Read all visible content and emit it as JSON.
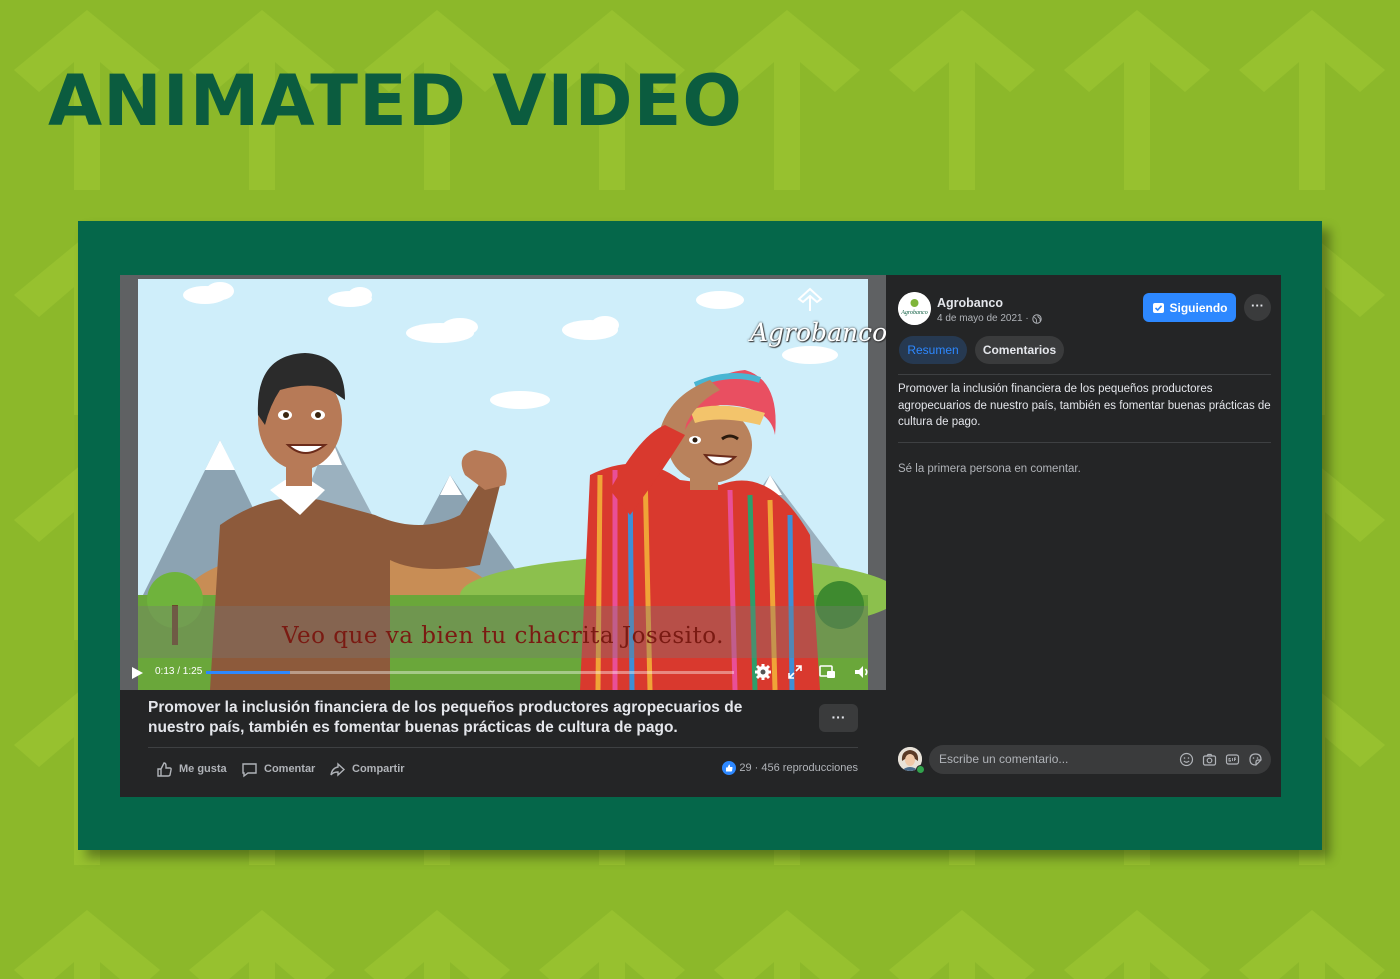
{
  "slide": {
    "title": "ANIMATED VIDEO",
    "colors": {
      "background": "#8cb82a",
      "title": "#0b5c3f",
      "frame": "#05674a"
    }
  },
  "video": {
    "brand_logo_text": "Agrobanco",
    "subtitle": "Veo que va bien tu chacrita Josesito.",
    "time_display": "0:13 / 1:25",
    "progress_fraction": 0.16,
    "control_icons": [
      "play-icon",
      "settings-icon",
      "expand-icon",
      "picture-in-picture-icon",
      "volume-icon"
    ]
  },
  "post": {
    "description": "Promover la inclusión financiera de los pequeños productores agropecuarios de nuestro país, también es fomentar buenas prácticas de cultura de pago.",
    "more_label": "···",
    "actions": {
      "like": "Me gusta",
      "comment": "Comentar",
      "share": "Compartir"
    },
    "likes_count": "29",
    "views": "· 456 reproducciones"
  },
  "sidebar": {
    "page_name": "Agrobanco",
    "avatar_text": "Agrobanco",
    "date": "4 de mayo de 2021 ·",
    "follow_label": "Siguiendo",
    "more_label": "···",
    "tabs": [
      {
        "label": "Resumen",
        "active": true
      },
      {
        "label": "Comentarios",
        "active": false
      }
    ],
    "description": "Promover la inclusión financiera de los pequeños productores agropecuarios de nuestro país, también es fomentar buenas prácticas de cultura de pago.",
    "empty_comments": "Sé la primera persona en comentar.",
    "comment_placeholder": "Escribe un comentario...",
    "comment_icons": [
      "emoji-icon",
      "camera-icon",
      "gif-icon",
      "sticker-icon"
    ],
    "accent": "#2d88ff"
  }
}
